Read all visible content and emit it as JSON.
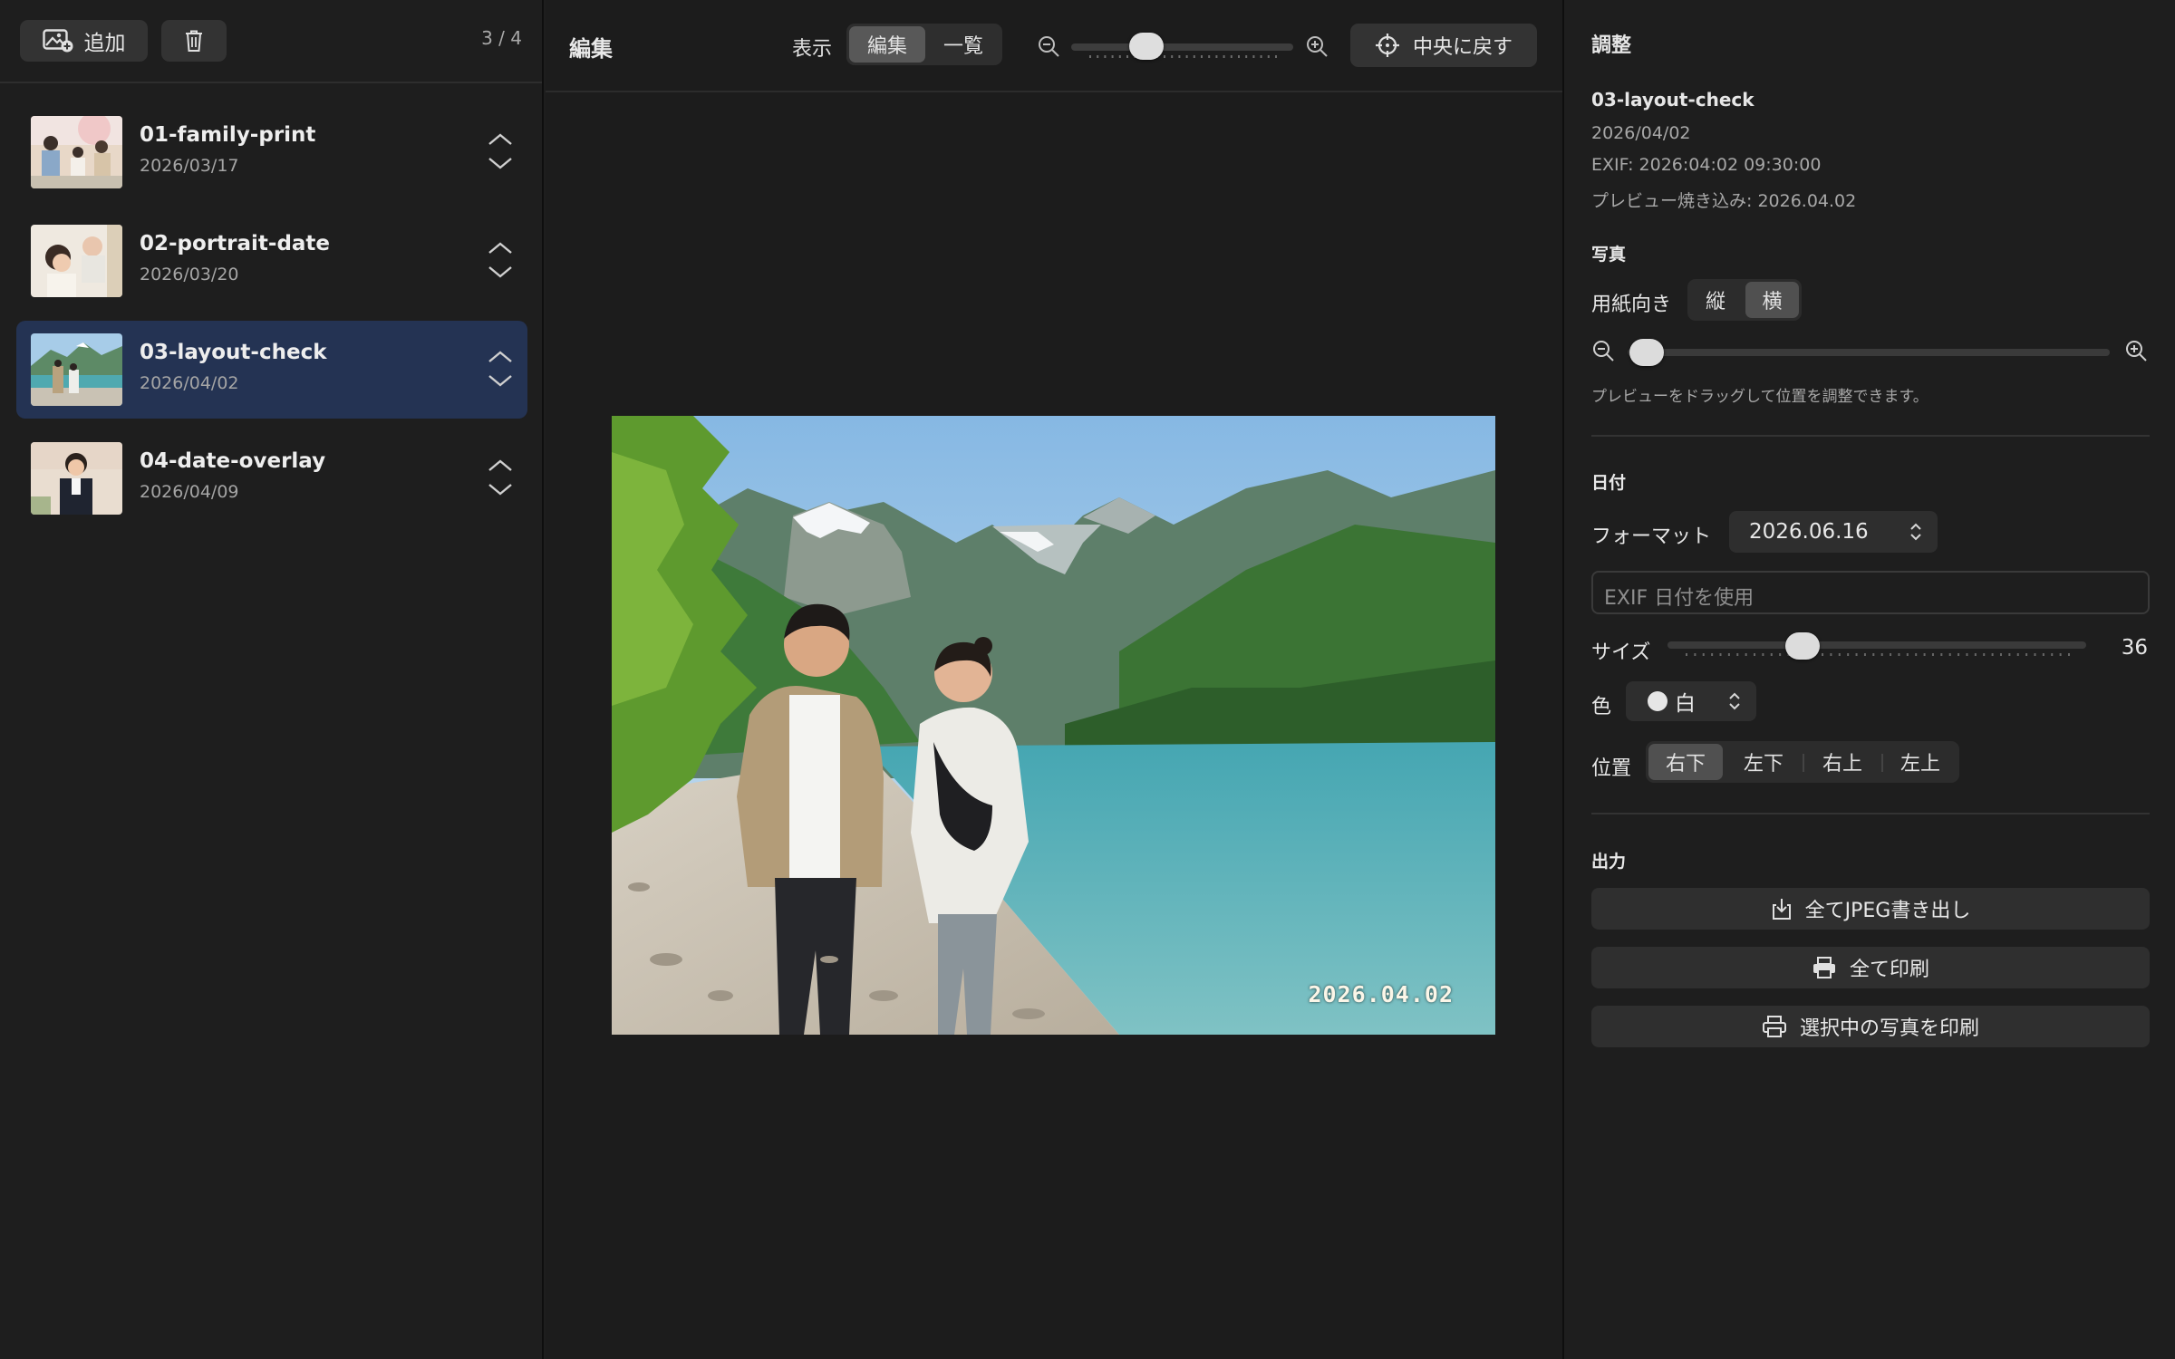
{
  "sidebar": {
    "add_label": "追加",
    "count": "3 / 4",
    "items": [
      {
        "name": "01-family-print",
        "date": "2026/03/17"
      },
      {
        "name": "02-portrait-date",
        "date": "2026/03/20"
      },
      {
        "name": "03-layout-check",
        "date": "2026/04/02"
      },
      {
        "name": "04-date-overlay",
        "date": "2026/04/09"
      }
    ],
    "selected_index": 2
  },
  "center": {
    "title": "編集",
    "view_label": "表示",
    "view_modes": [
      "編集",
      "一覧"
    ],
    "active_mode": "編集",
    "recenter_label": "中央に戻す",
    "date_stamp": "2026.04.02"
  },
  "panel": {
    "title": "調整",
    "file_name": "03-layout-check",
    "file_date": "2026/04/02",
    "exif": "EXIF: 2026:04:02 09:30:00",
    "preview_burn": "プレビュー焼き込み: 2026.04.02",
    "photo_section": "写真",
    "orientation_label": "用紙向き",
    "orientation_options": [
      "縦",
      "横"
    ],
    "orientation_selected": "横",
    "drag_hint": "プレビューをドラッグして位置を調整できます。",
    "date_section": "日付",
    "format_label": "フォーマット",
    "format_value": "2026.06.16",
    "exif_placeholder": "EXIF 日付を使用",
    "size_label": "サイズ",
    "size_value": "36",
    "color_label": "色",
    "color_value": "白",
    "position_label": "位置",
    "position_options": [
      "右下",
      "左下",
      "右上",
      "左上"
    ],
    "position_selected": "右下",
    "output_section": "出力",
    "export_all": "全てJPEG書き出し",
    "print_all": "全て印刷",
    "print_selected": "選択中の写真を印刷"
  },
  "colors": {
    "background": "#1e1e1e",
    "selected_row": "#243353",
    "button": "#333333",
    "segment_active": "#585858"
  },
  "icons": [
    "add-photo-icon",
    "trash-icon",
    "chevron-up-icon",
    "chevron-down-icon",
    "zoom-out-icon",
    "zoom-in-icon",
    "crosshair-icon",
    "updown-icon",
    "download-icon",
    "printer-icon"
  ]
}
